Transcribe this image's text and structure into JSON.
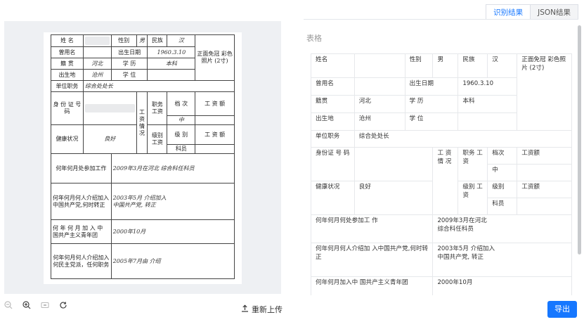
{
  "tabs": {
    "recognition_result": "识别结果",
    "json_result": "JSON结果"
  },
  "toolbar": {
    "reupload_label": "重新上传",
    "export_label": "导出"
  },
  "icons": {
    "zoom_out": "zoom-out-icon",
    "zoom_in": "zoom-in-icon",
    "fit": "fit-screen-icon",
    "rotate": "rotate-icon",
    "upload": "upload-icon"
  },
  "form_image": {
    "name_label": "姓  名",
    "gender_label": "性别",
    "gender_value": "男",
    "ethnicity_label": "民族",
    "ethnicity_value": "汉",
    "photo_label": "正面免冠 彩色照片 (2寸)",
    "former_name_label": "曾用名",
    "birth_date_label": "出生日期",
    "birth_date_value": "1960.3.10",
    "native_place_label": "籍  贯",
    "native_place_value": "河北",
    "education_label": "学  历",
    "education_value": "本科",
    "birthplace_label": "出生地",
    "birthplace_value": "沧州",
    "degree_label": "学  位",
    "work_unit_label": "单位职务",
    "work_unit_value": "综合处处长",
    "id_label": "身 份 证 号  码",
    "salary_label": "工资情况",
    "position_salary_label": "职务工资",
    "grade_label": "档  次",
    "amount_label": "工 资 额",
    "grade_value": "中",
    "health_label": "健康状况",
    "health_value": "良好",
    "level_salary_label": "级别工资",
    "level_label": "级  别",
    "level_value": "科员",
    "work_start_label": "何年何月处参加工作",
    "work_start_value": "2009年3月在河北 综合科任科员",
    "party_label": "何年何月何人介绍加入中国共产党,何时转正",
    "party_value_1": "2003年5月",
    "party_value_2": "介绍加入",
    "party_value_3": "中国共产党,",
    "party_value_4": "转正",
    "league_label": "何 年 何 月 加 入 中 国共产主义青年团",
    "league_value": "2000年10月",
    "democratic_label": "何年何月何人介绍加入何民主党派，任何职务",
    "democratic_value_1": "2005年7月由",
    "democratic_value_2": "介绍"
  },
  "result": {
    "section_title": "表格",
    "name_label": "姓名",
    "gender_label": "性别",
    "gender_value": "男",
    "ethnicity_label": "民族",
    "ethnicity_value": "汉",
    "photo_label": "正面免冠 彩色照片 (2寸)",
    "former_name_label": "曾用名",
    "birth_date_label": "出生日期",
    "birth_date_value": "1960.3.10",
    "native_place_label": "籍贯",
    "native_place_value": "河北",
    "education_label": "学 历",
    "education_value": "本科",
    "birthplace_label": "出生地",
    "birthplace_value": "沧州",
    "degree_label": "学 位",
    "work_unit_label": "单位职务",
    "work_unit_value": "综合处处长",
    "id_label": "身份证 号 码",
    "salary_label": "工 资 情 况",
    "position_salary_label": "职务 工资",
    "grade_label": "档次",
    "amount_label": "工资额",
    "grade_value": "中",
    "health_label": "健康状况",
    "health_value": "良好",
    "level_salary_label": "级别 工资",
    "level_label": "级别",
    "amount_label_2": "工资额",
    "level_value": "科员",
    "work_start_label": "何年何月何处参加工 作",
    "work_start_value_1": "2009年3月在河北",
    "work_start_value_2": "综合科任科员",
    "party_label": "何年何月何人介绍加 入中国共产党,何时转 正",
    "party_value_1": "2003年5月",
    "party_value_2": "介绍加入",
    "party_value_3": "中国共产党,",
    "party_value_4": "转正",
    "league_label": "何年何月加入中 国共产主义青年团",
    "league_value": "2000年10月"
  }
}
